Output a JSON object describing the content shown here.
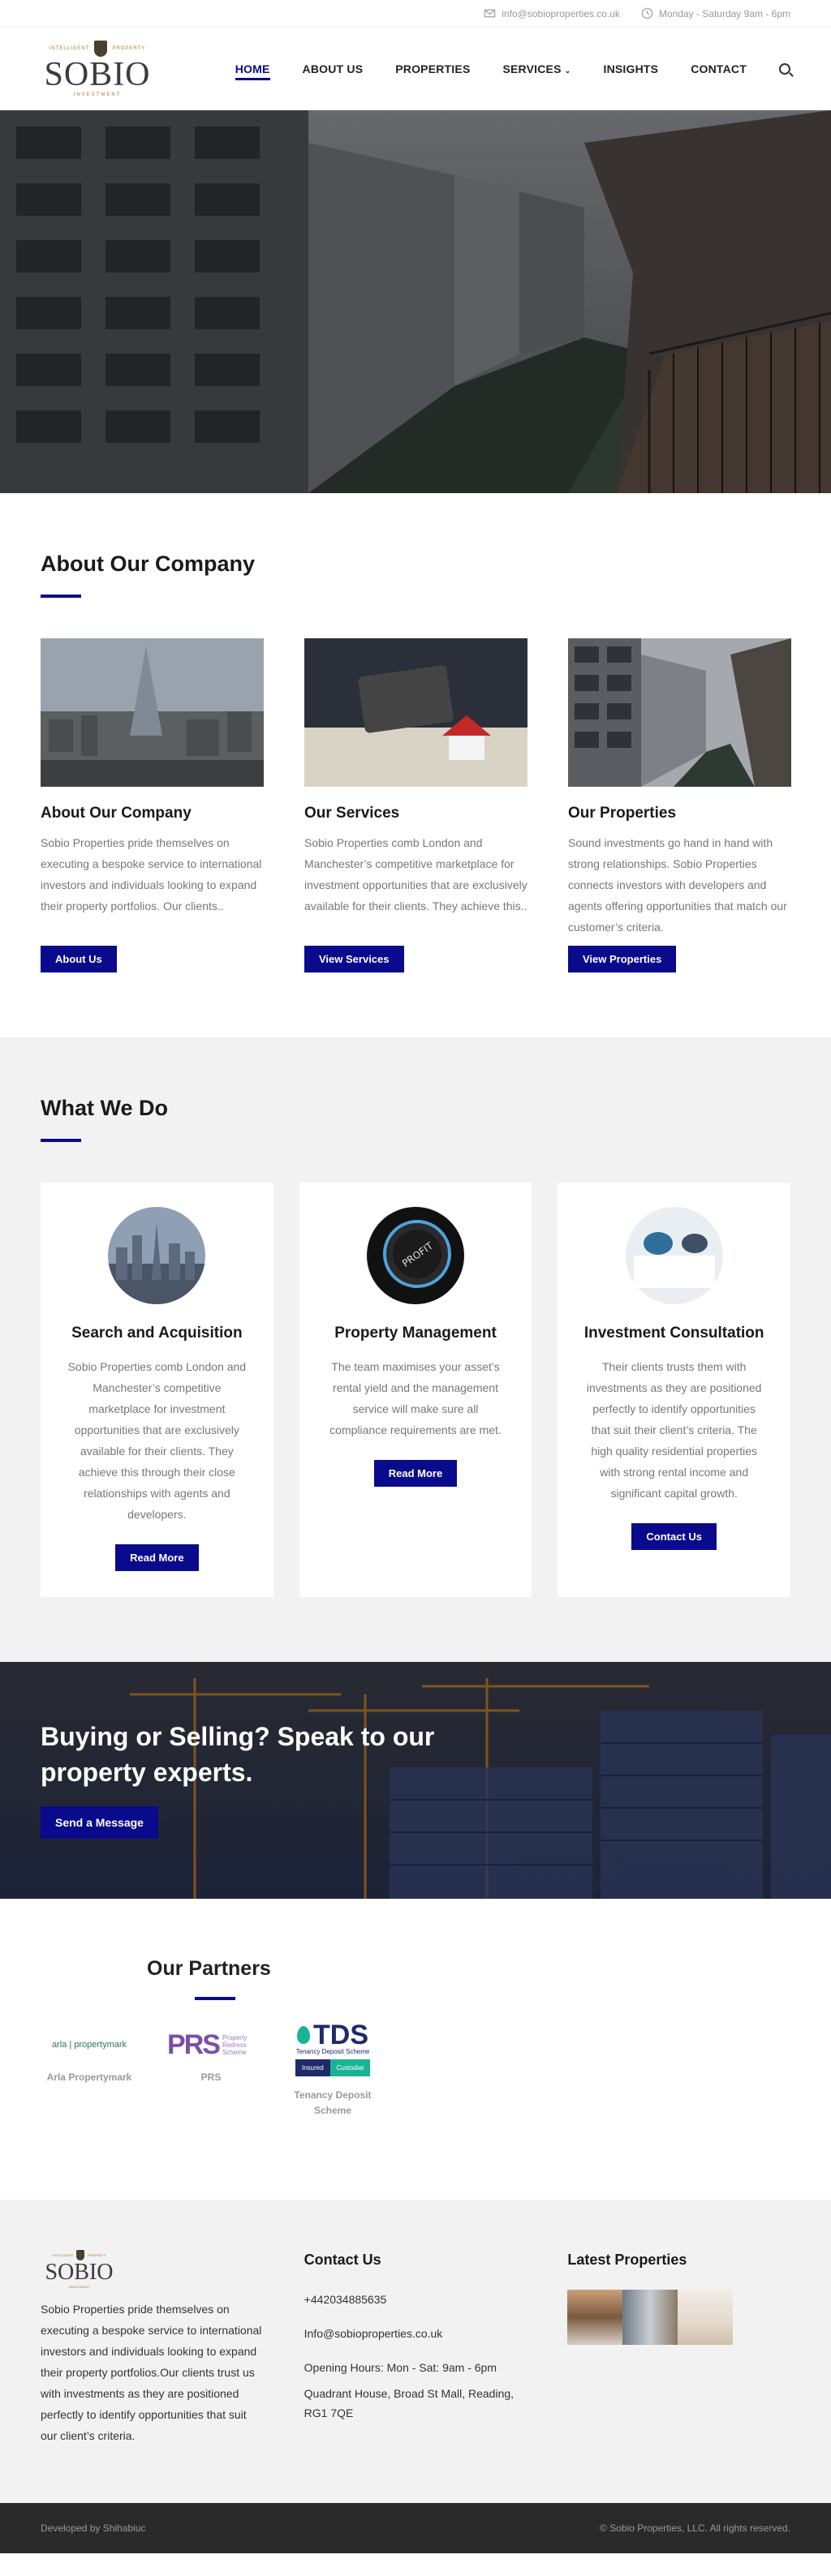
{
  "topbar": {
    "email": "info@sobioproperties.co.uk",
    "hours": "Monday - Saturday 9am - 6pm"
  },
  "logo": {
    "left_tag": "INTELLIGENT",
    "right_tag": "PROPERTY",
    "name": "SOBIO",
    "sub": "INVESTMENT"
  },
  "nav": {
    "items": [
      "HOME",
      "ABOUT US",
      "PROPERTIES",
      "SERVICES",
      "INSIGHTS",
      "CONTACT"
    ]
  },
  "about": {
    "heading": "About Our Company",
    "cards": [
      {
        "title": "About Our Company",
        "text": "Sobio Properties pride themselves on executing a bespoke service to international investors and individuals looking to expand their property portfolios. Our clients..",
        "button": "About Us"
      },
      {
        "title": "Our Services",
        "text": "Sobio Properties comb London and Manchester’s competitive marketplace for investment opportunities that are exclusively available for their clients. They achieve this..",
        "button": "View Services"
      },
      {
        "title": "Our Properties",
        "text": "Sound investments go hand in hand with strong relationships. Sobio Properties connects investors with developers and agents offering opportunities that match our customer’s criteria.",
        "button": "View Properties"
      }
    ]
  },
  "what": {
    "heading": "What We Do",
    "cards": [
      {
        "title": "Search and Acquisition",
        "text": "Sobio Properties comb London and Manchester’s competitive marketplace for investment opportunities that are exclusively available for their clients. They achieve this through their close relationships with agents and developers.",
        "button": "Read More"
      },
      {
        "title": "Property Management",
        "text": "The team maximises your asset’s rental yield and the management service will make sure all compliance requirements are met.",
        "button": "Read More"
      },
      {
        "title": "Investment Consultation",
        "text": "Their clients trusts them with investments as they are positioned perfectly to identify opportunities that suit their client’s criteria. The high quality residential properties with strong rental income and significant capital growth.",
        "button": "Contact Us"
      }
    ]
  },
  "cta": {
    "heading": "Buying or Selling? Speak to our property experts.",
    "button": "Send a Message"
  },
  "partners": {
    "heading": "Our Partners",
    "items": [
      {
        "logo_text": "arla | propertymark",
        "name": "Arla Propertymark"
      },
      {
        "logo_text": "PRS",
        "logo_sub": "Property Redress Scheme",
        "name": "PRS"
      },
      {
        "logo_text": "TDS",
        "logo_sub": "Tenancy Deposit Scheme",
        "badge_left": "Insured",
        "badge_right": "Custodial",
        "name": "Tenancy Deposit Scheme"
      }
    ]
  },
  "footer": {
    "about_text": "Sobio Properties pride themselves on executing a bespoke service to international investors and individuals looking to expand their property portfolios.Our clients trust us with investments as they are positioned perfectly to identify opportunities that suit our client’s criteria.",
    "contact_heading": "Contact Us",
    "phone": "+442034885635",
    "email": "Info@sobioproperties.co.uk",
    "hours": "Opening Hours: Mon - Sat: 9am - 6pm",
    "address": "Quadrant House, Broad St Mall, Reading, RG1 7QE",
    "latest_heading": "Latest Properties"
  },
  "bottombar": {
    "left": "Developed by Shihabiuc",
    "right": "© Sobio Properties, LLC. All rights reserved."
  },
  "colors": {
    "accent": "#0a0a8c",
    "gold": "#b07a2c"
  }
}
